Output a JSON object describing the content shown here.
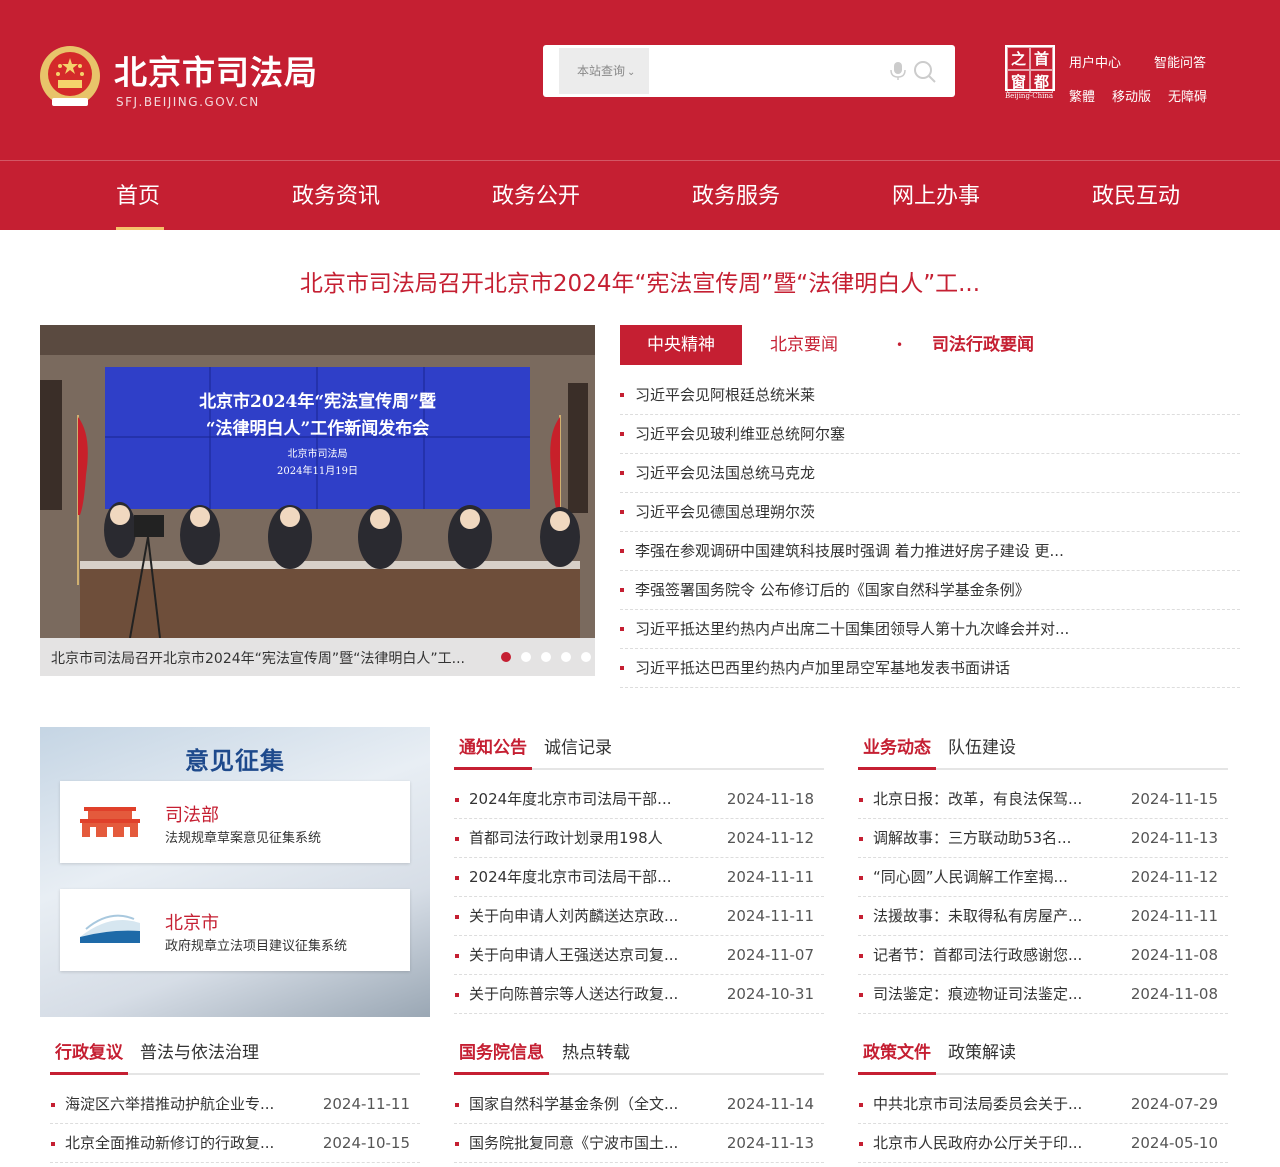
{
  "header": {
    "site_title": "北京市司法局",
    "site_domain": "SFJ.BEIJING.GOV.CN",
    "search_scope": "本站查询",
    "search_placeholder": "",
    "capital_logo_chars": [
      "之",
      "首",
      "窗",
      "都"
    ],
    "capital_logo_sub": "Beijing-China",
    "links": {
      "user_center": "用户中心",
      "smart_qa": "智能问答",
      "traditional": "繁體",
      "mobile": "移动版",
      "accessibility": "无障碍"
    },
    "colors": {
      "brand": "#c51f32",
      "nav_active": "#f5c26b"
    }
  },
  "nav": {
    "items": [
      "首页",
      "政务资讯",
      "政务公开",
      "政务服务",
      "网上办事",
      "政民互动"
    ]
  },
  "headline": "北京市司法局召开北京市2024年“宪法宣传周”暨“法律明白人”工...",
  "slideshow": {
    "caption": "北京市司法局召开北京市2024年“宪法宣传周”暨“法律明白人”工...",
    "screen_line1": "北京市2024年“宪法宣传周”暨",
    "screen_line2": "“法律明白人”工作新闻发布会",
    "screen_line3": "北京市司法局",
    "screen_line4": "2024年11月19日"
  },
  "news_tabs": {
    "tab1": "中央精神",
    "tab2": "北京要闻",
    "tab3": "司法行政要闻",
    "items": [
      "习近平会见阿根廷总统米莱",
      "习近平会见玻利维亚总统阿尔塞",
      "习近平会见法国总统马克龙",
      "习近平会见德国总理朔尔茨",
      "李强在参观调研中国建筑科技展时强调 着力推进好房子建设 更...",
      "李强签署国务院令 公布修订后的《国家自然科学基金条例》",
      "习近平抵达里约热内卢出席二十国集团领导人第十九次峰会并对...",
      "习近平抵达巴西里约热内卢加里昂空军基地发表书面讲话"
    ]
  },
  "opinion": {
    "title": "意见征集",
    "card1_title": "司法部",
    "card1_sub": "法规规章草案意见征集系统",
    "card2_title": "北京市",
    "card2_sub": "政府规章立法项目建议征集系统"
  },
  "notice": {
    "tab_active": "通知公告",
    "tab_other": "诚信记录",
    "rows": [
      {
        "text": "2024年度北京市司法局干部...",
        "date": "2024-11-18"
      },
      {
        "text": "首都司法行政计划录用198人",
        "date": "2024-11-12"
      },
      {
        "text": "2024年度北京市司法局干部...",
        "date": "2024-11-11"
      },
      {
        "text": "关于向申请人刘芮麟送达京政...",
        "date": "2024-11-11"
      },
      {
        "text": "关于向申请人王强送达京司复...",
        "date": "2024-11-07"
      },
      {
        "text": "关于向陈普宗等人送达行政复...",
        "date": "2024-10-31"
      }
    ]
  },
  "business": {
    "tab_active": "业务动态",
    "tab_other": "队伍建设",
    "rows": [
      {
        "text": "北京日报：改革，有良法保驾...",
        "date": "2024-11-15"
      },
      {
        "text": "调解故事：三方联动助53名...",
        "date": "2024-11-13"
      },
      {
        "text": "“同心圆”人民调解工作室揭...",
        "date": "2024-11-12"
      },
      {
        "text": "法援故事：未取得私有房屋产...",
        "date": "2024-11-11"
      },
      {
        "text": "记者节：首都司法行政感谢您...",
        "date": "2024-11-08"
      },
      {
        "text": "司法鉴定：痕迹物证司法鉴定...",
        "date": "2024-11-08"
      }
    ]
  },
  "review": {
    "tab_active": "行政复议",
    "tab_other": "普法与依法治理",
    "rows": [
      {
        "text": "海淀区六举措推动护航企业专...",
        "date": "2024-11-11"
      },
      {
        "text": "北京全面推动新修订的行政复...",
        "date": "2024-10-15"
      }
    ]
  },
  "state_council": {
    "tab_active": "国务院信息",
    "tab_other": "热点转载",
    "rows": [
      {
        "text": "国家自然科学基金条例（全文...",
        "date": "2024-11-14"
      },
      {
        "text": "国务院批复同意《宁波市国土...",
        "date": "2024-11-13"
      }
    ]
  },
  "policy": {
    "tab_active": "政策文件",
    "tab_other": "政策解读",
    "rows": [
      {
        "text": "中共北京市司法局委员会关于...",
        "date": "2024-07-29"
      },
      {
        "text": "北京市人民政府办公厅关于印...",
        "date": "2024-05-10"
      }
    ]
  }
}
